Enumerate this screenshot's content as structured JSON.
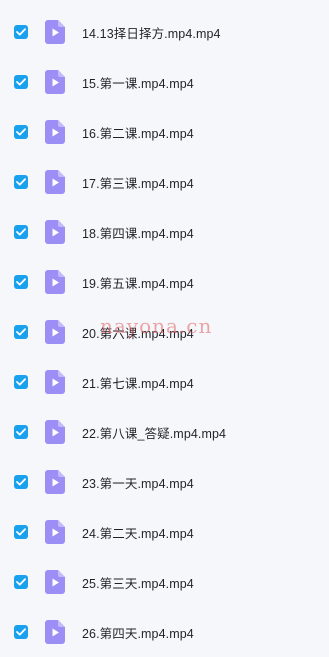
{
  "colors": {
    "background": "#f6f7fb",
    "checkbox": "#1aa1ee",
    "video_icon": "#9b8ff5",
    "text": "#1f2329",
    "watermark": "#e15f5f"
  },
  "icons": {
    "checkbox": "checkmark-icon",
    "file": "video-file-icon"
  },
  "files": [
    {
      "name": "14.13择日择方.mp4.mp4",
      "checked": true
    },
    {
      "name": "15.第一课.mp4.mp4",
      "checked": true
    },
    {
      "name": "16.第二课.mp4.mp4",
      "checked": true
    },
    {
      "name": "17.第三课.mp4.mp4",
      "checked": true
    },
    {
      "name": "18.第四课.mp4.mp4",
      "checked": true
    },
    {
      "name": "19.第五课.mp4.mp4",
      "checked": true
    },
    {
      "name": "20.第六课.mp4.mp4",
      "checked": true
    },
    {
      "name": "21.第七课.mp4.mp4",
      "checked": true
    },
    {
      "name": "22.第八课_答疑.mp4.mp4",
      "checked": true
    },
    {
      "name": "23.第一天.mp4.mp4",
      "checked": true
    },
    {
      "name": "24.第二天.mp4.mp4",
      "checked": true
    },
    {
      "name": "25.第三天.mp4.mp4",
      "checked": true
    },
    {
      "name": "26.第四天.mp4.mp4",
      "checked": true
    }
  ],
  "watermark": "nayona.cn"
}
